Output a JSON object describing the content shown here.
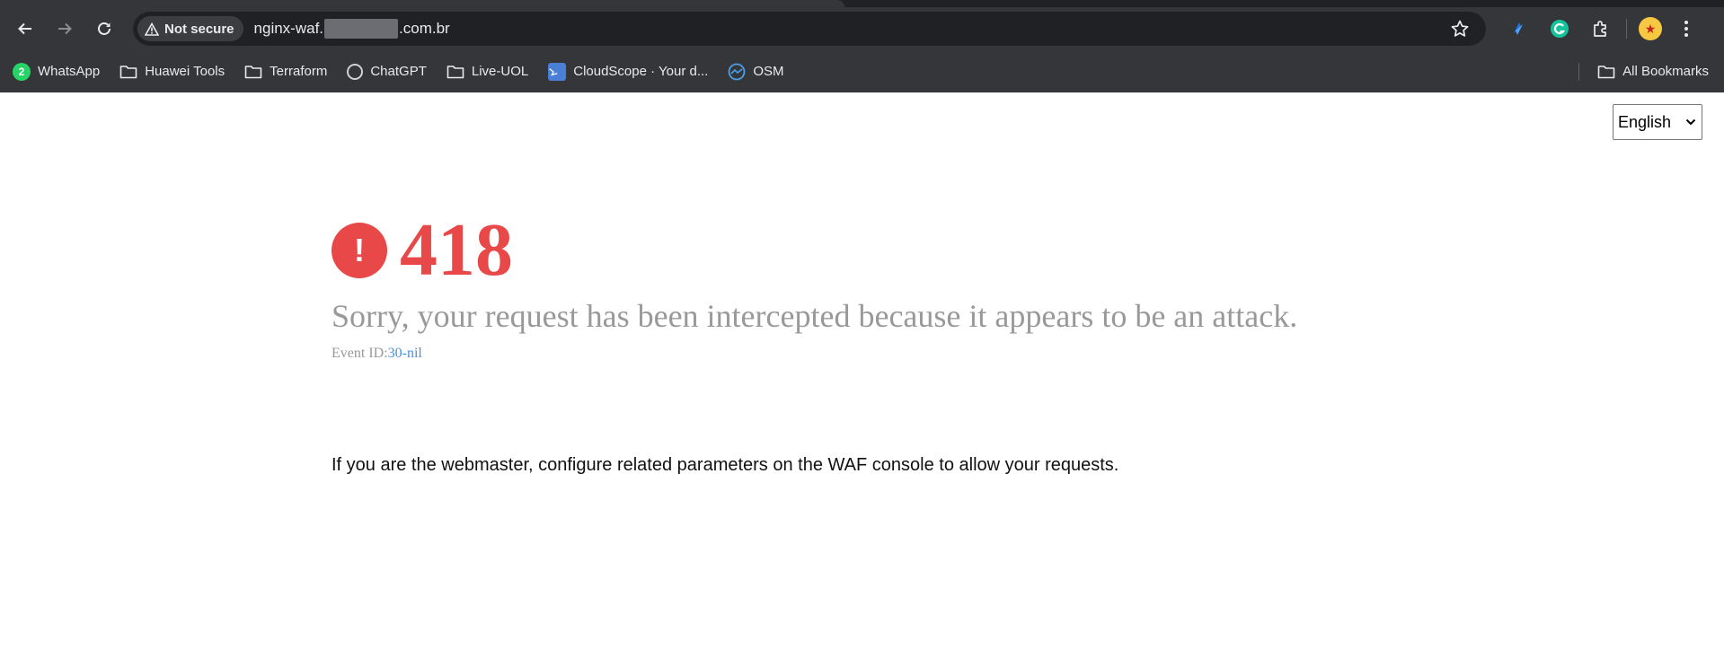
{
  "browser": {
    "security_label": "Not secure",
    "url_prefix": "nginx-waf.",
    "url_suffix": ".com.br",
    "bookmarks": [
      {
        "label": "WhatsApp",
        "icon": "whatsapp-icon",
        "badge": "2"
      },
      {
        "label": "Huawei Tools",
        "icon": "folder-icon"
      },
      {
        "label": "Terraform",
        "icon": "folder-icon"
      },
      {
        "label": "ChatGPT",
        "icon": "chatgpt-icon"
      },
      {
        "label": "Live-UOL",
        "icon": "folder-icon"
      },
      {
        "label": "CloudScope · Your d...",
        "icon": "cloudscope-icon"
      },
      {
        "label": "OSM",
        "icon": "osm-icon"
      }
    ],
    "all_bookmarks_label": "All Bookmarks"
  },
  "page": {
    "language_selected": "English",
    "error_code": "418",
    "headline": "Sorry, your request has been intercepted because it appears to be an attack.",
    "event_label": "Event ID:",
    "event_value": "30-nil",
    "webmaster_message": "If you are the webmaster, configure related parameters on the WAF console to allow your requests."
  },
  "colors": {
    "accent_red": "#e84848",
    "muted_text": "#999999",
    "link_blue": "#4a90d9",
    "chrome_bg": "#35363a"
  }
}
